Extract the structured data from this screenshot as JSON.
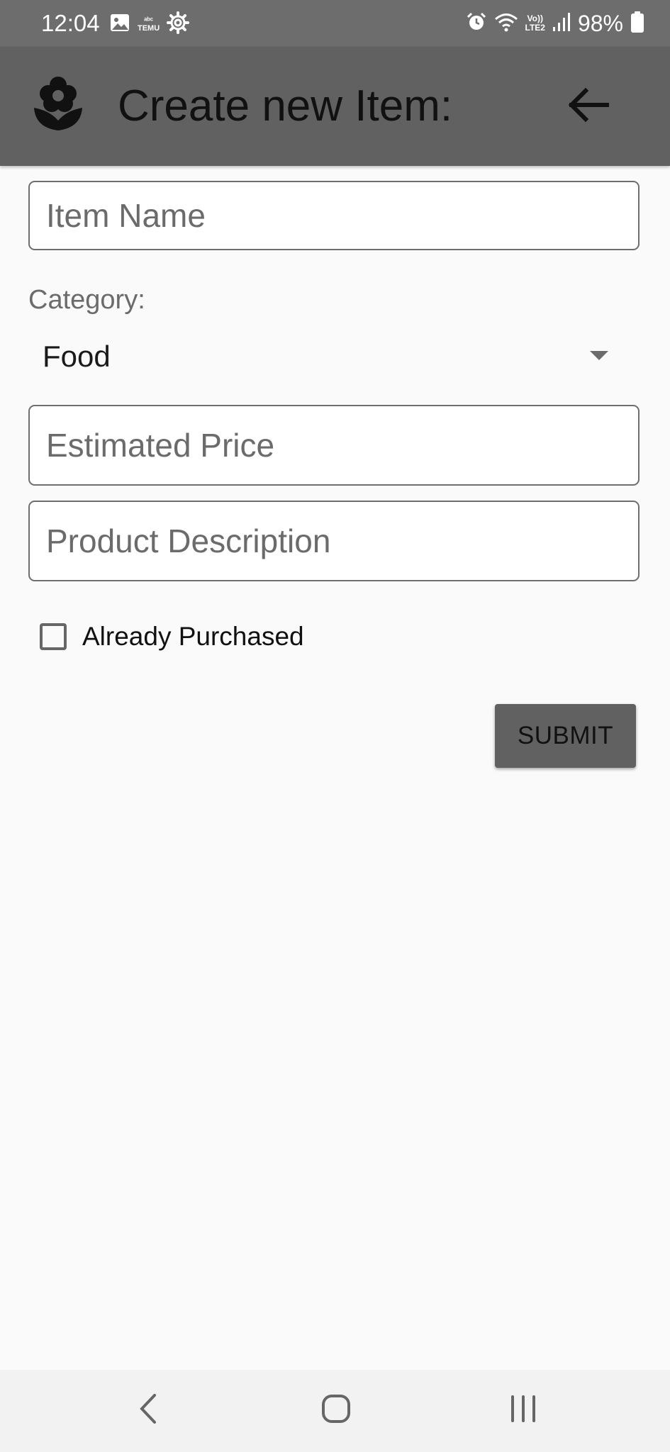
{
  "status_bar": {
    "time": "12:04",
    "battery": "98%",
    "icons_left": [
      "gallery-icon",
      "temu-icon",
      "settings-gear-icon"
    ],
    "icons_right": [
      "alarm-icon",
      "wifi-icon",
      "volte-icon",
      "signal-icon",
      "battery-icon"
    ],
    "volte_top": "Vo))",
    "volte_bottom": "LTE2",
    "temu_top": "ᵃᵇᶜ",
    "temu_bottom": "TEMU"
  },
  "app_bar": {
    "title": "Create new Item:",
    "logo_icon": "flower-icon",
    "back_icon": "arrow-back-icon"
  },
  "form": {
    "item_name": {
      "placeholder": "Item Name",
      "value": ""
    },
    "category": {
      "label": "Category:",
      "selected": "Food"
    },
    "estimated_price": {
      "placeholder": "Estimated Price",
      "value": ""
    },
    "product_description": {
      "placeholder": "Product Description",
      "value": ""
    },
    "already_purchased": {
      "label": "Already Purchased",
      "checked": false
    },
    "submit_label": "SUBMIT"
  },
  "nav_bar": {
    "back_icon": "nav-back-icon",
    "home_icon": "nav-home-icon",
    "recents_icon": "nav-recents-icon"
  },
  "colors": {
    "status_bar": "#6d6d6d",
    "app_bar": "#616161",
    "background": "#fafafa",
    "button": "#616161",
    "field_border": "#6e6e6e"
  }
}
